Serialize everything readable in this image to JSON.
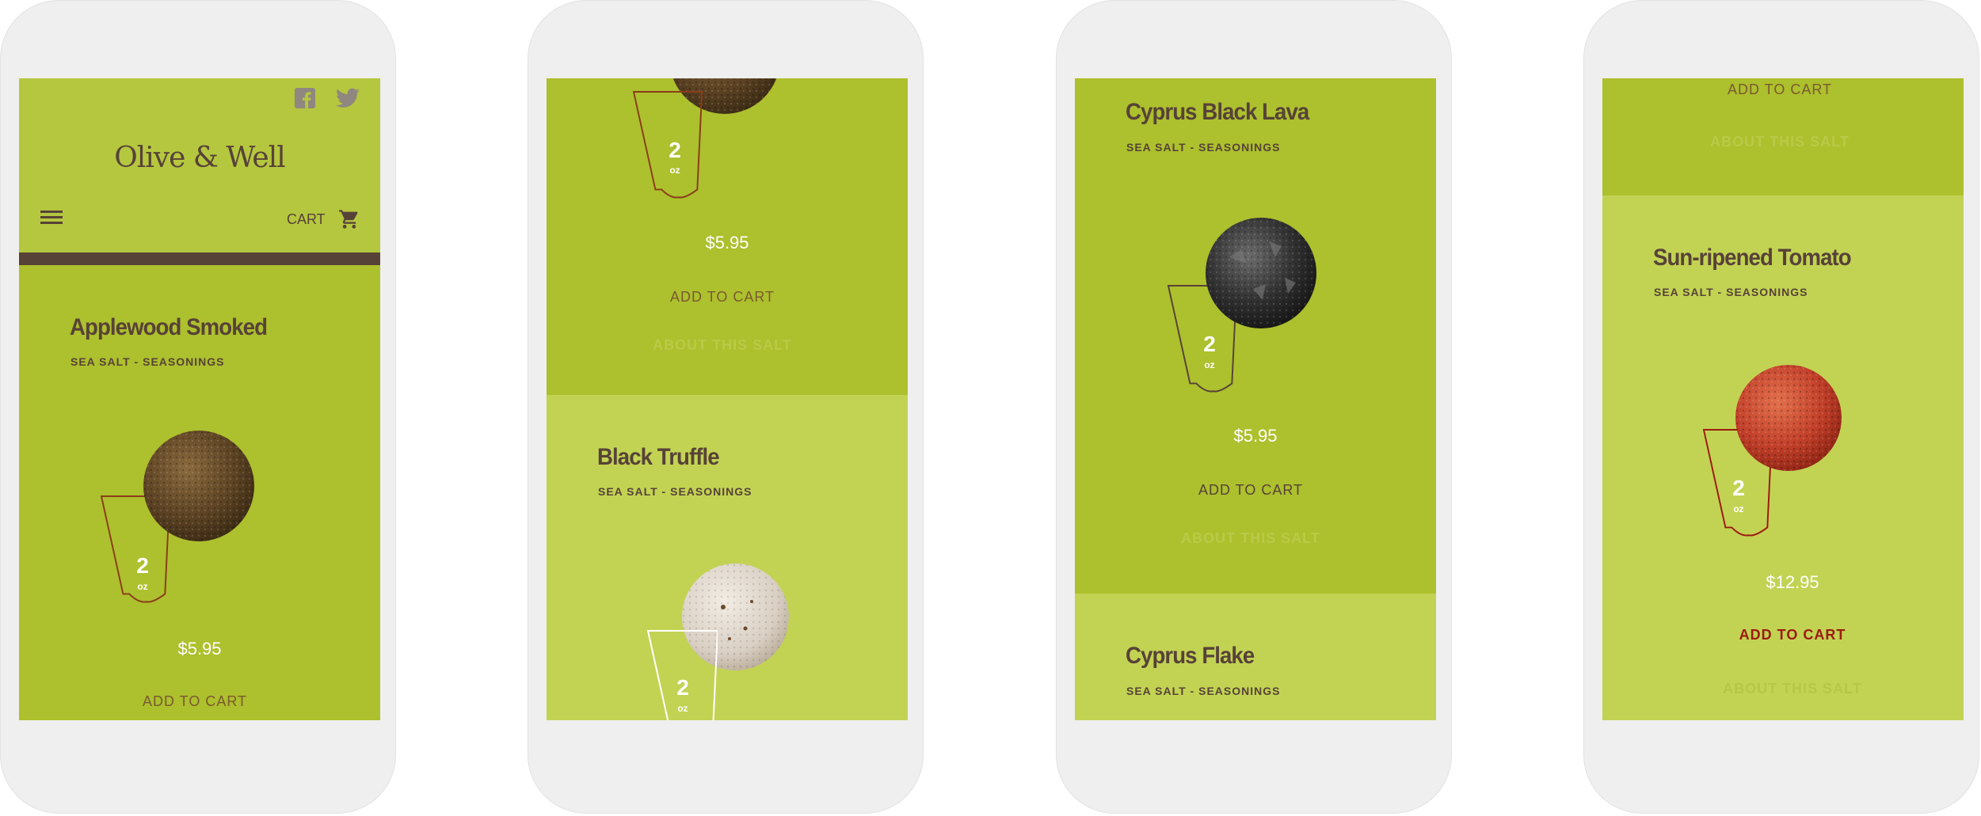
{
  "colors": {
    "dark_green": "#adc02d",
    "light_green": "#c2d353",
    "brown": "#574238",
    "add_to_cart_red": "#9c1a10",
    "bag_outline": "#8a3d1a"
  },
  "header": {
    "brand": "Olive & Well",
    "cart_label": "CART",
    "social": [
      "facebook-icon",
      "twitter-icon"
    ],
    "menu_icon": "hamburger-icon",
    "cart_icon": "shopping-cart-icon"
  },
  "common": {
    "subtitle": "SEA SALT - SEASONINGS",
    "add_to_cart": "ADD TO CART",
    "about": "ABOUT THIS SALT",
    "oz_num": "2",
    "oz_unit": "oz"
  },
  "products": [
    {
      "name": "Applewood Smoked",
      "price": "$5.95"
    },
    {
      "name": "Black Truffle",
      "price": "$5.95"
    },
    {
      "name": "Cyprus Black Lava",
      "price": "$5.95"
    },
    {
      "name": "Cyprus Flake",
      "price": ""
    },
    {
      "name": "Sun-ripened Tomato",
      "price": "$12.95"
    }
  ]
}
